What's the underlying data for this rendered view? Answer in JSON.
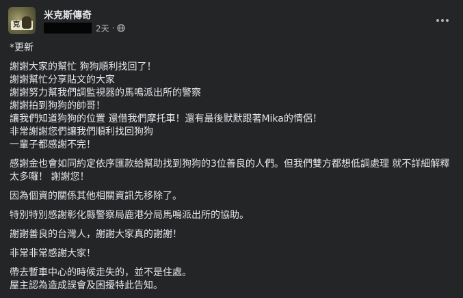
{
  "post": {
    "page_name": "米克斯傳奇",
    "avatar_text": "克",
    "timestamp": "2天",
    "separator": "·",
    "audience_icon": "globe-icon",
    "more_icon": "more-options-icon",
    "paragraphs": [
      [
        "*更新"
      ],
      [
        "謝謝大家的幫忙 狗狗順利找回了！",
        "謝謝幫忙分享貼文的大家",
        "謝謝努力幫我們調監視器的馬鳴派出所的警察",
        "謝謝拍到狗狗的帥哥！",
        "讓我們知道狗狗的位置 還借我們摩托車！還有最後默默跟著Mika的情侶！",
        "非常謝謝您們讓我們順利找回狗狗",
        "一輩子都感謝不完！"
      ],
      [
        "感謝金也會如同約定依序匯款給幫助找到狗狗的3位善良的人們。但我們雙方都想低調處理 就不詳細解釋太多囉！ 謝謝您！"
      ],
      [
        "因為個資的關係其他相關資訊先移除了。"
      ],
      [
        "特別特別感謝彰化縣警察局鹿港分局馬鳴派出所的協助。"
      ],
      [
        "謝謝善良的台灣人，謝謝大家真的謝謝！"
      ],
      [
        "非常非常感謝大家！"
      ],
      [
        "帶去暫車中心的時候走失的，並不是住處。",
        "屋主認為造成誤會及困擾特此告知。"
      ]
    ]
  },
  "colors": {
    "background": "#242526",
    "primary_text": "#e4e6eb",
    "secondary_text": "#b0b3b8"
  }
}
